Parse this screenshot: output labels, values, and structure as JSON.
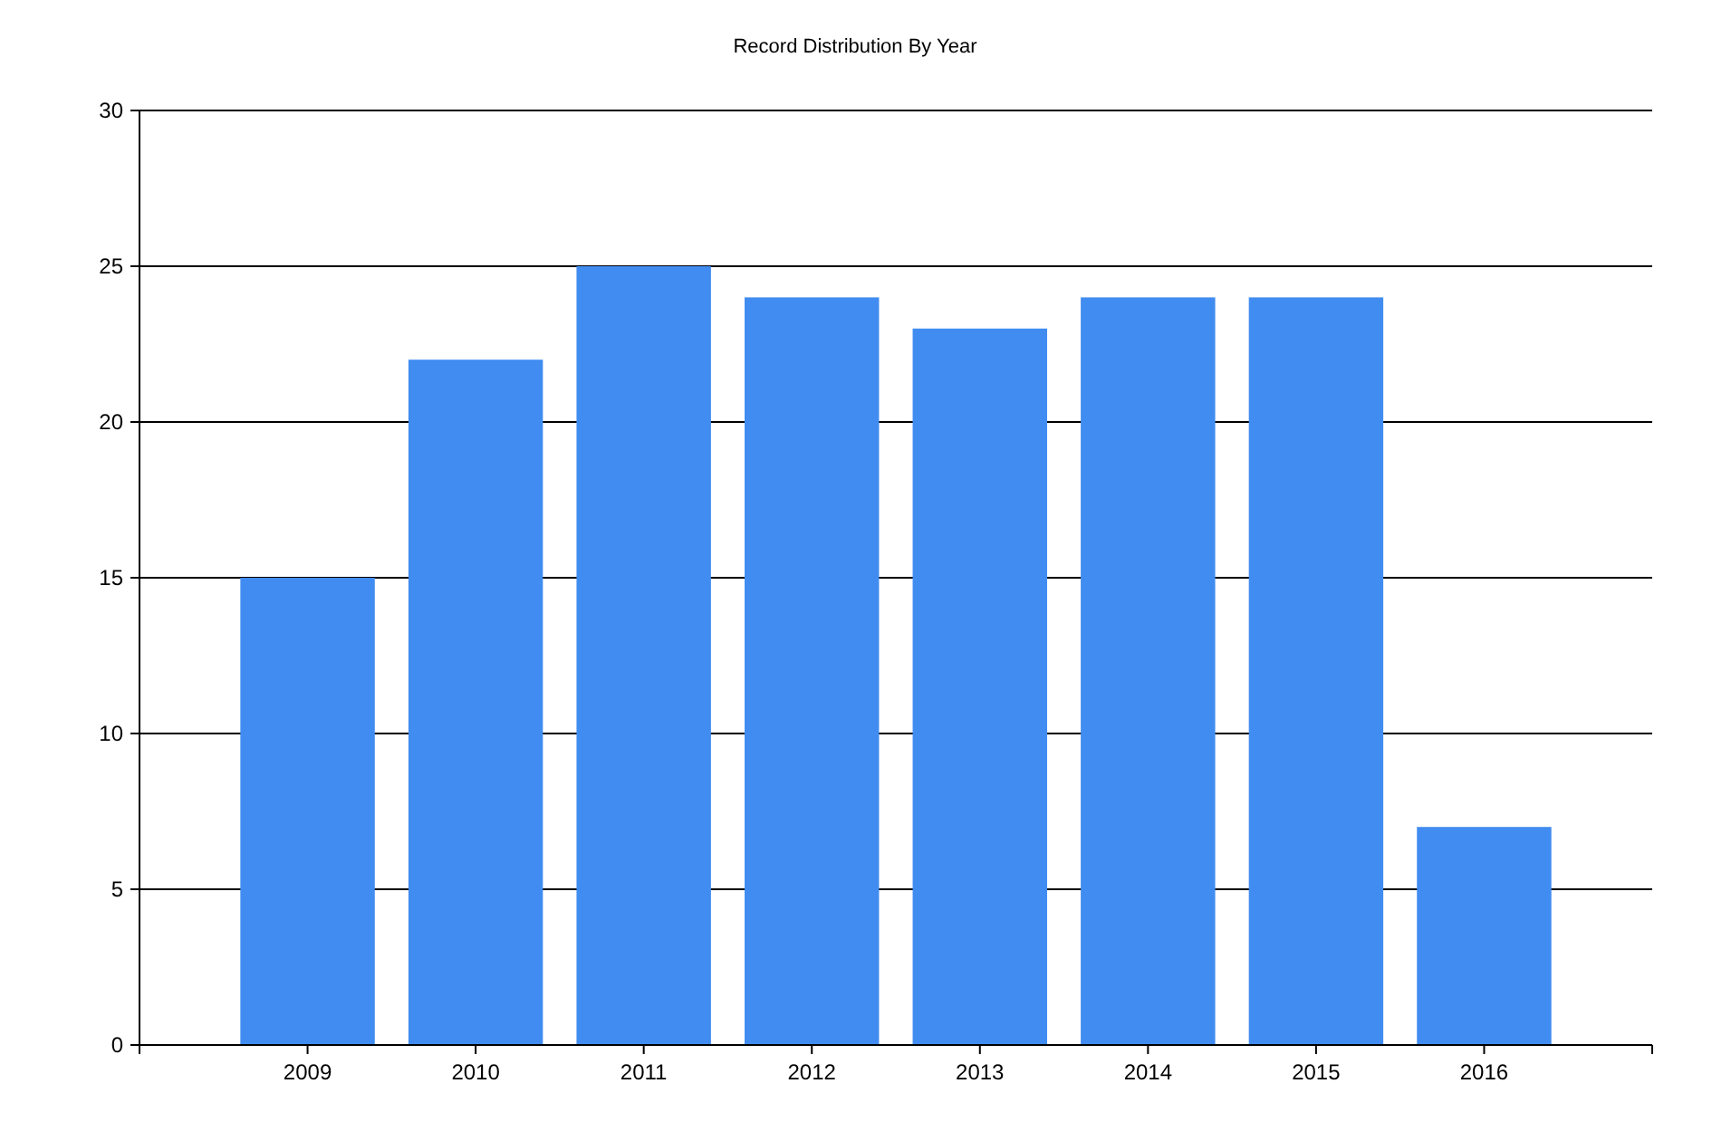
{
  "chart_data": {
    "type": "bar",
    "title": "Record Distribution By Year",
    "categories": [
      "2009",
      "2010",
      "2011",
      "2012",
      "2013",
      "2014",
      "2015",
      "2016"
    ],
    "series": [
      {
        "color": "#418cf0",
        "values": [
          15,
          22,
          25,
          24,
          23,
          24,
          24,
          7
        ]
      }
    ],
    "ylim": [
      0,
      30
    ],
    "grid": true,
    "yticks": [
      0,
      5,
      10,
      15,
      20,
      25,
      30
    ]
  }
}
